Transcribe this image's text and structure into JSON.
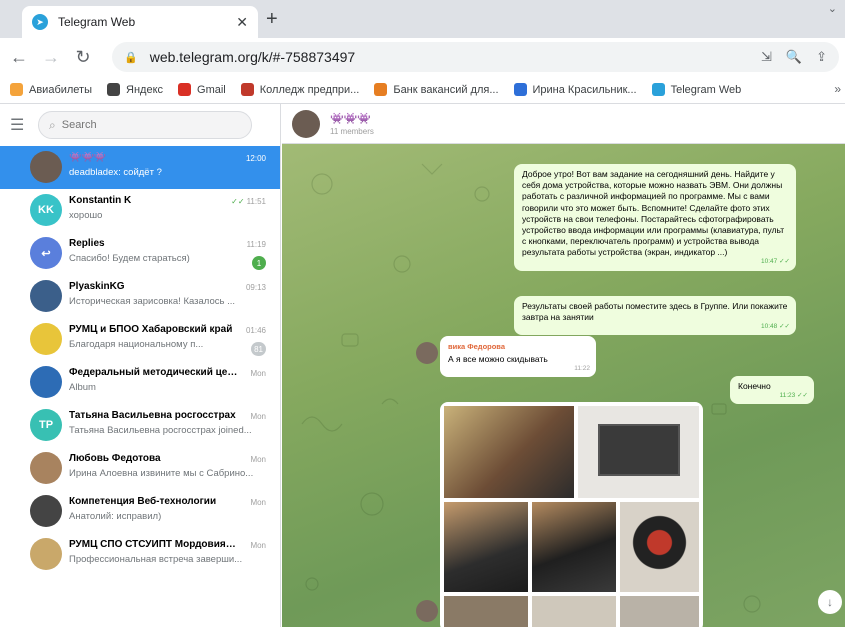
{
  "browser": {
    "tab_title": "Telegram Web",
    "url": "web.telegram.org/k/#-758873497",
    "bookmarks": [
      {
        "label": "Авиабилеты",
        "color": "#f4a33b"
      },
      {
        "label": "Яндекс",
        "color": "#444444"
      },
      {
        "label": "Gmail",
        "color": "#d93025"
      },
      {
        "label": "Колледж предпри...",
        "color": "#c0392b"
      },
      {
        "label": "Банк вакансий для...",
        "color": "#e67e22"
      },
      {
        "label": "Ирина Красильник...",
        "color": "#2e6fd8"
      },
      {
        "label": "Telegram Web",
        "color": "#2aa1da"
      }
    ]
  },
  "sidebar": {
    "search_placeholder": "Search",
    "chats": [
      {
        "initials": "",
        "avatar_color": "#6b5c52",
        "name": "👾👾👾",
        "message": "deadbladex: coйдёт ?",
        "time": "12:00",
        "unread": "",
        "active": true
      },
      {
        "initials": "KK",
        "avatar_color": "#39c3c8",
        "name": "Konstantin K",
        "message": "хорошо",
        "time": "11:51",
        "unread": "",
        "ticks": true
      },
      {
        "initials": "↩",
        "avatar_color": "#5a7fdc",
        "name": "Replies",
        "message": "Спасибо! Будем стараться)",
        "time": "11:19",
        "unread": "1"
      },
      {
        "initials": "",
        "avatar_color": "#3b5f8a",
        "name": "PlyaskinKG",
        "message": "Историческая зарисовка! Казалось ...",
        "time": "09:13",
        "unread": ""
      },
      {
        "initials": "",
        "avatar_color": "#e8c53a",
        "name": "РУМЦ и БПОО Хабаровский край",
        "message": "Благодаря национальному п...",
        "time": "01:46",
        "unread": "81",
        "muted": true
      },
      {
        "initials": "",
        "avatar_color": "#2d6cb5",
        "name": "Федеральный методический центр ...",
        "message": "Album",
        "time": "Mon",
        "unread": ""
      },
      {
        "initials": "TP",
        "avatar_color": "#38c0b3",
        "name": "Татьяна Васильевна росгосстрах",
        "message": "Татьяна Васильевна росгосстрах joined...",
        "time": "Mon",
        "unread": ""
      },
      {
        "initials": "",
        "avatar_color": "#a8835f",
        "name": "Любовь Федотова",
        "message": "Ирина Алоевна извините мы с Сабрино...",
        "time": "Mon",
        "unread": ""
      },
      {
        "initials": "",
        "avatar_color": "#444444",
        "name": "Компетенция Веб-технологии",
        "message": "Анатолий: исправил)",
        "time": "Mon",
        "unread": ""
      },
      {
        "initials": "",
        "avatar_color": "#c9a86a",
        "name": "РУМЦ СПО СТСУИПТ Мордовия-Сар...",
        "message": "Профессиональная встреча заверши...",
        "time": "Mon",
        "unread": ""
      }
    ]
  },
  "chat": {
    "title": "👾👾👾",
    "members": "11 members",
    "messages": [
      {
        "text": "Доброе утро! Вот вам задание на сегодняшний день. Найдите у себя дома устройства, которые можно назвать ЭВМ. Они должны работать с различной информацией по программе. Мы с вами говорили что это может быть. Вспомните! Сделайте фото этих устройств на свои телефоны. Постарайтесь сфотографировать устройство ввода информации или программы (клавиатура, пульт с кнопками, переключатель программ) и устройства вывода результата работы устройства (экран, индикатор ...)",
        "time": "10:47"
      },
      {
        "text": "Результаты своей работы поместите здесь в Группе. Или покажите завтра на занятии",
        "time": "10:48"
      },
      {
        "sender": "вика Федорова",
        "text": "А я все можно скидывать",
        "time": "11:22"
      },
      {
        "text": "Конечно",
        "time": "11:23"
      }
    ]
  }
}
